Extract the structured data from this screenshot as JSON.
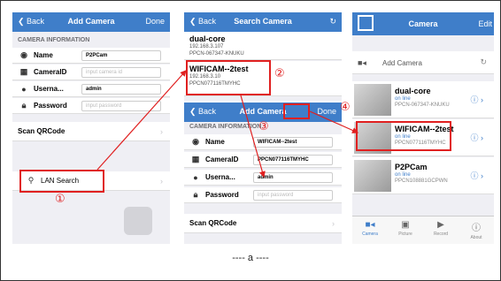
{
  "screen1": {
    "back": "Back",
    "title": "Add Camera",
    "done": "Done",
    "section": "CAMERA INFORMATION",
    "rows": [
      {
        "label": "Name",
        "value": "P2PCam",
        "placeholder": ""
      },
      {
        "label": "CameraID",
        "value": "",
        "placeholder": "input camera id"
      },
      {
        "label": "Userna...",
        "value": "admin",
        "placeholder": ""
      },
      {
        "label": "Password",
        "value": "",
        "placeholder": "input password"
      }
    ],
    "scan": "Scan QRCode",
    "lan": "LAN Search",
    "num": "①"
  },
  "screen2": {
    "back": "Back",
    "title": "Search Camera",
    "results": [
      {
        "name": "dual-core",
        "ip": "192.168.3.107",
        "id": "PPCN-067347-KNUKU"
      },
      {
        "name": "WIFICAM--2test",
        "ip": "192.168.3.10",
        "id": "PPCN077116TMYHC"
      }
    ],
    "num": "②"
  },
  "screen3": {
    "back": "Back",
    "title": "Add Camera",
    "done": "Done",
    "section": "CAMERA INFORMATION",
    "rows": [
      {
        "label": "Name",
        "value": "WIFICAM--2test",
        "placeholder": ""
      },
      {
        "label": "CameraID",
        "value": "PPCN077116TMYHC",
        "placeholder": ""
      },
      {
        "label": "Userna...",
        "value": "admin",
        "placeholder": ""
      },
      {
        "label": "Password",
        "value": "",
        "placeholder": "input password"
      }
    ],
    "scan": "Scan QRCode",
    "num": "③"
  },
  "screen4": {
    "title": "Camera",
    "edit": "Edit",
    "add": "Add Camera",
    "cams": [
      {
        "name": "dual-core",
        "status": "on line",
        "id": "PPCN-067347-KNUKU"
      },
      {
        "name": "WIFICAM--2test",
        "status": "on line",
        "id": "PPCN077116TMYHC"
      },
      {
        "name": "P2PCam",
        "status": "on line",
        "id": "PPCN108881GCPWN"
      }
    ],
    "tabs": [
      "Camera",
      "Picture",
      "Record",
      "About"
    ],
    "num": "④"
  },
  "caption": "---- a ----",
  "colors": {
    "accent": "#3f7ec9",
    "highlight": "#e02020"
  }
}
